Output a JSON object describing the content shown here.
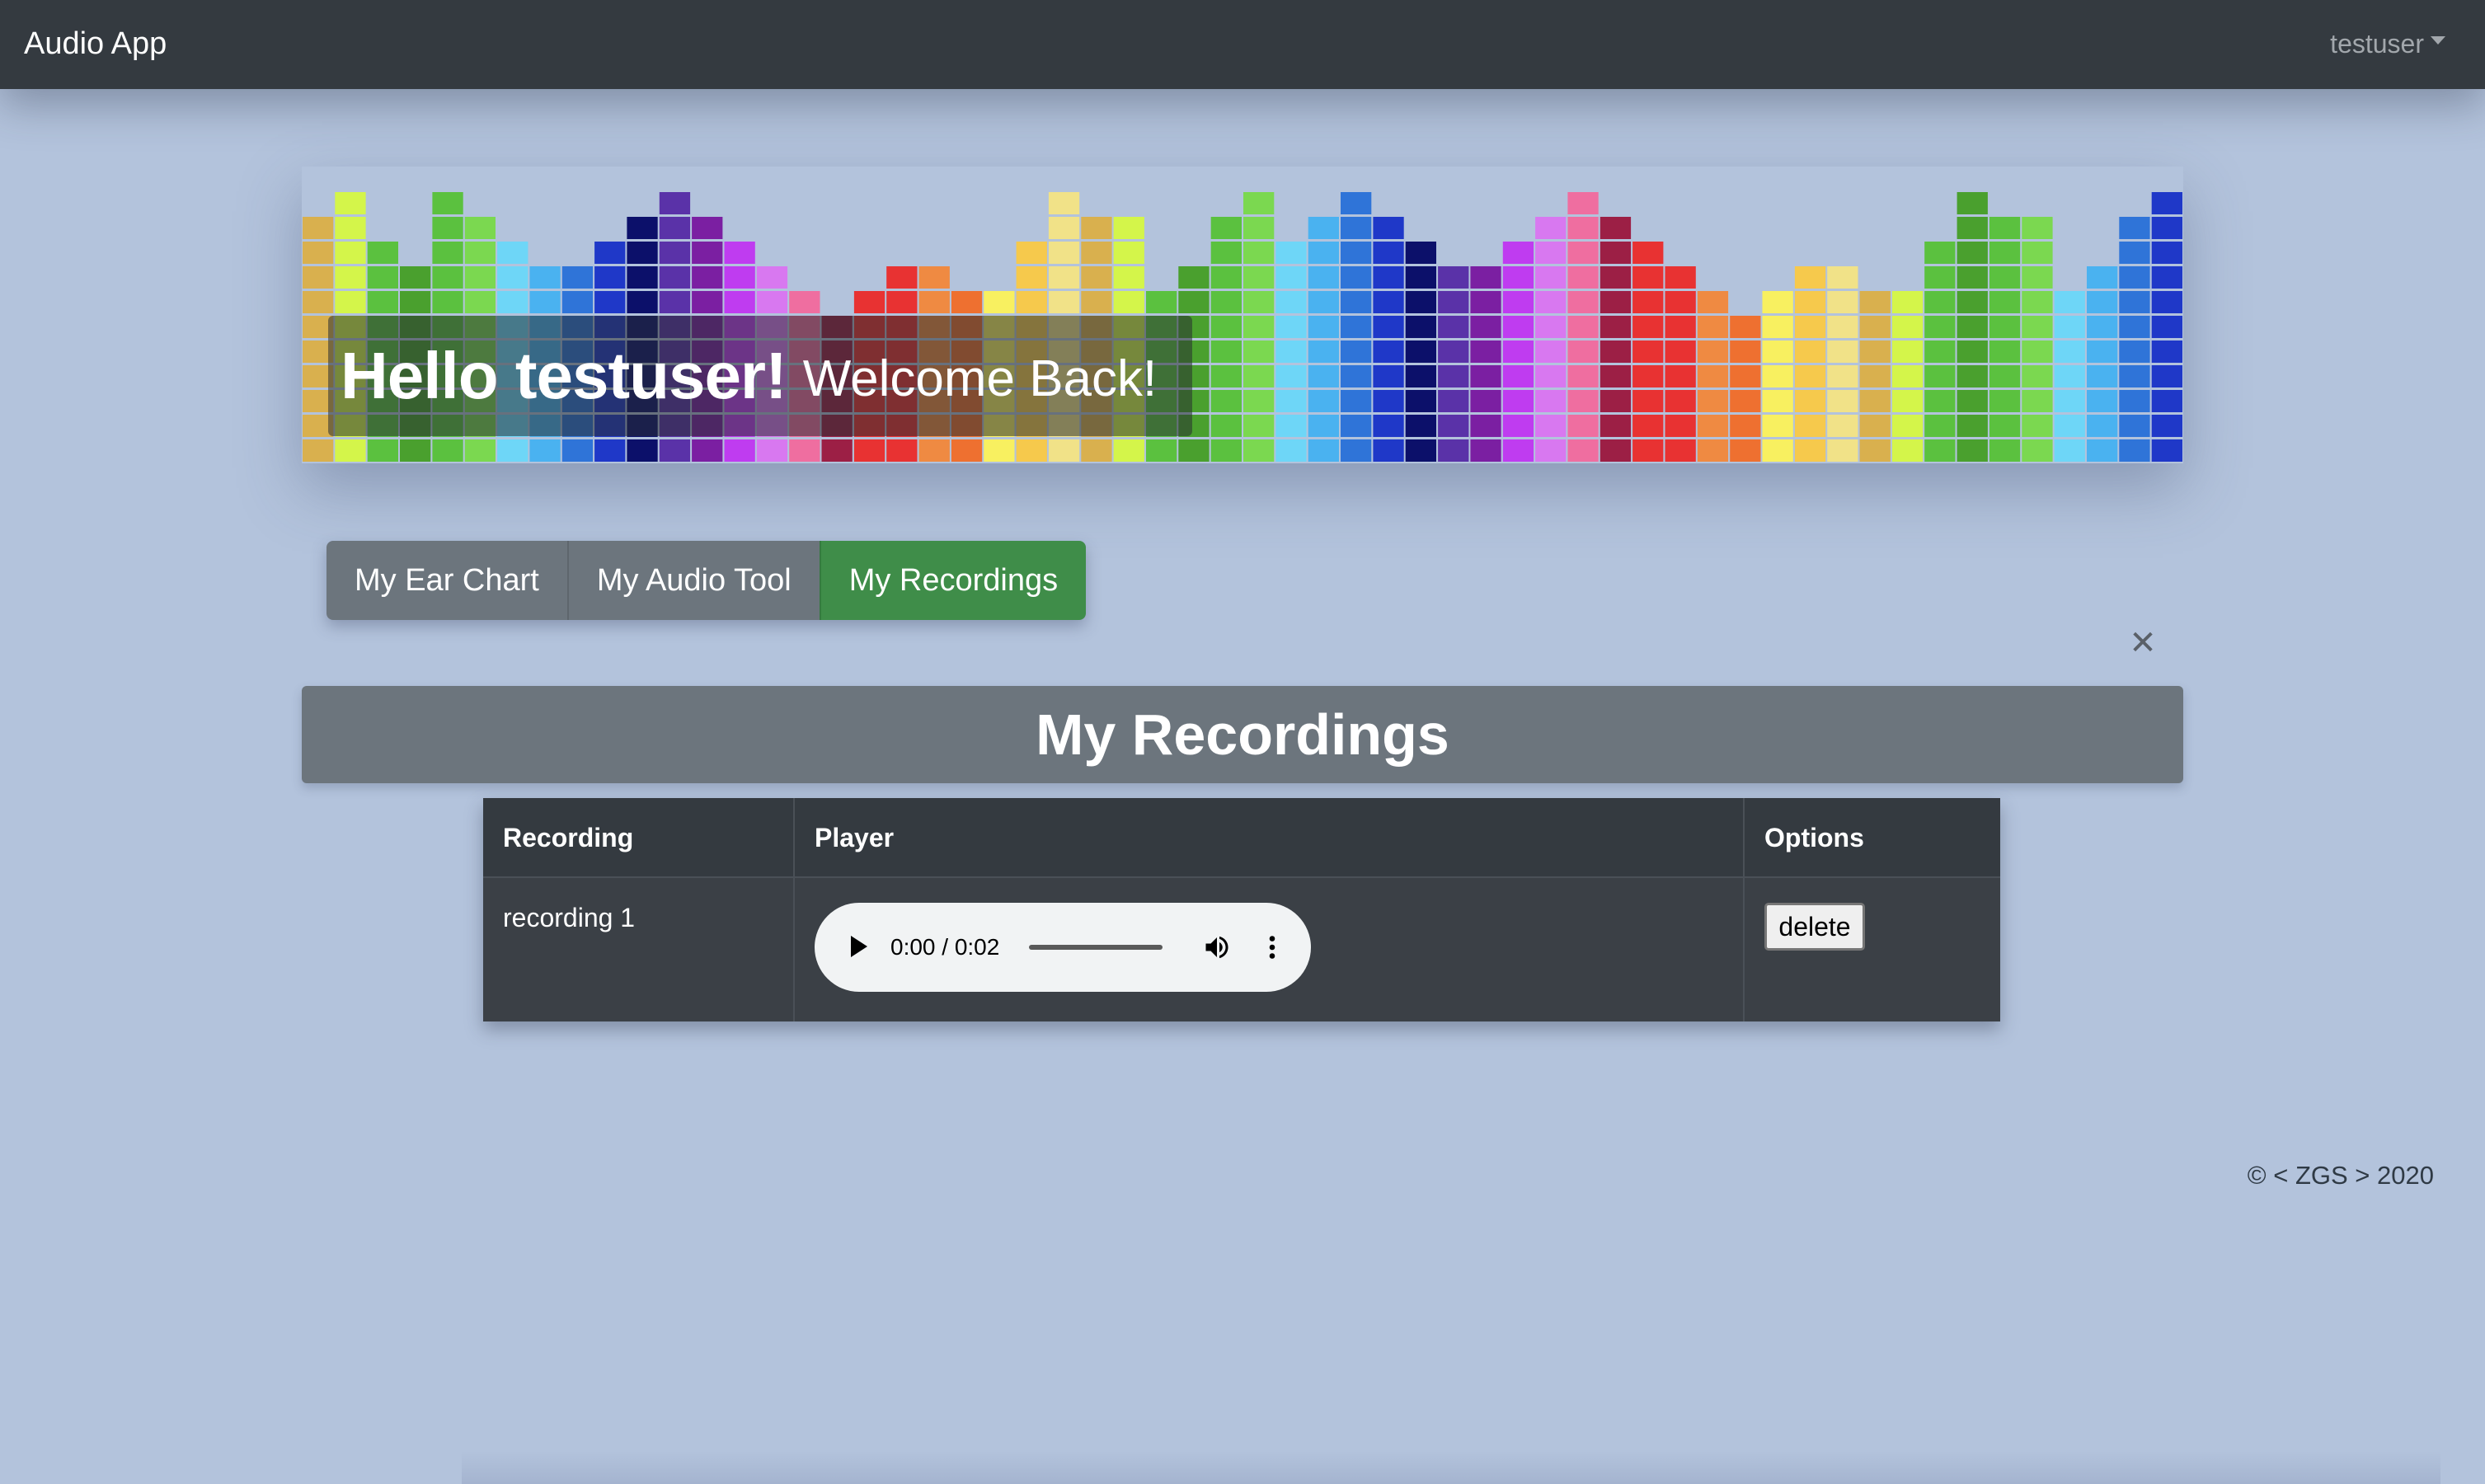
{
  "navbar": {
    "brand": "Audio App",
    "user": "testuser",
    "user_caret_icon": "caret-down-icon"
  },
  "banner": {
    "greeting_strong": "Hello testuser!",
    "greeting_rest": "Welcome Back!",
    "equalizer_levels": [
      10,
      11,
      9,
      8,
      11,
      10,
      9,
      8,
      8,
      9,
      10,
      11,
      10,
      9,
      8,
      7,
      6,
      7,
      8,
      8,
      7,
      7,
      9,
      11,
      10,
      10,
      7,
      8,
      10,
      11,
      9,
      10,
      11,
      10,
      9,
      8,
      8,
      9,
      10,
      11,
      10,
      9,
      8,
      7,
      6,
      7,
      8,
      8,
      7,
      7,
      9,
      11,
      10,
      10,
      7,
      8,
      10,
      11
    ],
    "equalizer_colors": [
      "#d9b04e",
      "#d4f54a",
      "#5bc13f",
      "#4aa02e",
      "#5bc13f",
      "#7bd850",
      "#6ed6f7",
      "#4ab2f0",
      "#2f74d8",
      "#1f38c8",
      "#0c106a",
      "#5a32a8",
      "#7b1fa2",
      "#bf3cf0",
      "#d878f0",
      "#ef6ea0",
      "#9c1f45",
      "#e83232",
      "#e83232",
      "#ef8a42",
      "#ee7030",
      "#f8f060",
      "#f6c94c",
      "#f1e288"
    ],
    "colors": {
      "page_bg": "#b3c3dc",
      "navbar_bg": "#343a40",
      "tab_bg": "#6c757d",
      "tab_active_bg": "#3f8d49"
    }
  },
  "tabs": [
    {
      "label": "My Ear Chart",
      "active": false
    },
    {
      "label": "My Audio Tool",
      "active": false
    },
    {
      "label": "My Recordings",
      "active": true
    }
  ],
  "close_icon": "close-icon",
  "section": {
    "title": "My Recordings"
  },
  "table": {
    "headers": [
      "Recording",
      "Player",
      "Options"
    ],
    "rows": [
      {
        "recording": "recording 1",
        "player": {
          "time": "0:00 / 0:02",
          "progress": 0,
          "icons": [
            "play-icon",
            "volume-icon",
            "more-vert-icon"
          ]
        },
        "option_label": "delete"
      }
    ]
  },
  "footer": {
    "text": "© < ZGS > 2020"
  }
}
